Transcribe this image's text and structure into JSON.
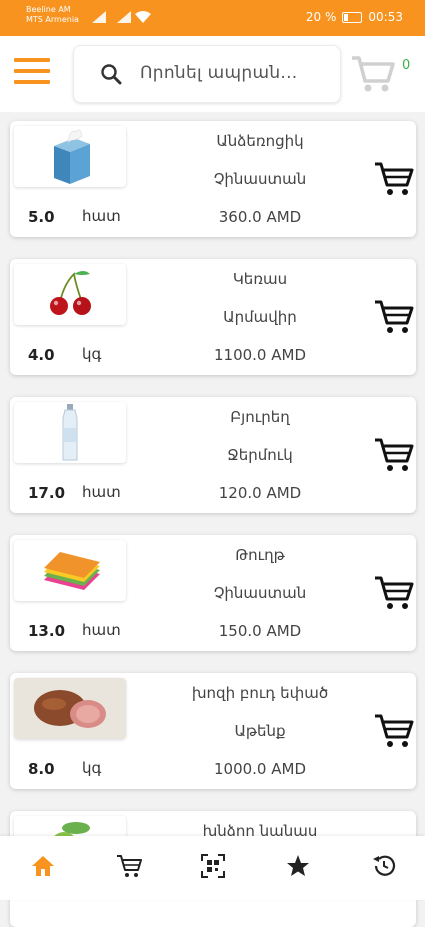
{
  "status_bar": {
    "carrier_line1": "Beeline AM",
    "carrier_line2": "MTS Armenia",
    "battery": "20 %",
    "time": "00:53"
  },
  "header": {
    "search_placeholder": "Որոնել ապրան...",
    "cart_count": "0"
  },
  "products": [
    {
      "name": "Անձեռոցիկ",
      "store": "Չինաստան",
      "price": "360.0 AMD",
      "qty": "5.0",
      "unit": "հատ",
      "image": "tissue-box"
    },
    {
      "name": "Կեռաս",
      "store": "Արմավիր",
      "price": "1100.0 AMD",
      "qty": "4.0",
      "unit": "կգ",
      "image": "cherries"
    },
    {
      "name": "Բյուրեղ",
      "store": "Ջերմուկ",
      "price": "120.0 AMD",
      "qty": "17.0",
      "unit": "հատ",
      "image": "water-bottle"
    },
    {
      "name": "Թուղթ",
      "store": "Չինաստան",
      "price": "150.0 AMD",
      "qty": "13.0",
      "unit": "հատ",
      "image": "sticky-notes"
    },
    {
      "name": "խոզի բուդ եփած",
      "store": "Աթենք",
      "price": "1000.0 AMD",
      "qty": "8.0",
      "unit": "կգ",
      "image": "cooked-ham"
    },
    {
      "name": "խնձոր նանաս",
      "image": "apple"
    }
  ],
  "bottom_nav": [
    "home-icon",
    "cart-icon",
    "qr-scan-icon",
    "star-icon",
    "history-icon"
  ],
  "colors": {
    "accent": "#f7931e",
    "cart_count": "#3cb043",
    "nav_active": "#f7931e"
  }
}
